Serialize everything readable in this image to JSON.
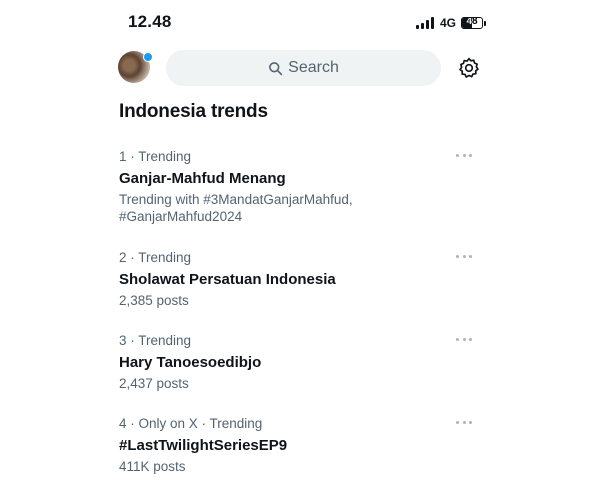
{
  "status_bar": {
    "time": "12.48",
    "network": "4G",
    "battery_level": "48",
    "battery_fraction": 0.48
  },
  "header": {
    "search_placeholder": "Search",
    "notification_dot_color": "#1d9bf0"
  },
  "section": {
    "title": "Indonesia trends"
  },
  "trends": [
    {
      "meta": "1 · Trending",
      "name": "Ganjar-Mahfud Menang",
      "sub_line1": "Trending with #3MandatGanjarMahfud,",
      "sub_line2": "#GanjarMahfud2024"
    },
    {
      "meta": "2 · Trending",
      "name": "Sholawat Persatuan Indonesia",
      "sub": "2,385 posts"
    },
    {
      "meta": "3 · Trending",
      "name": "Hary Tanoesoedibjo",
      "sub": "2,437 posts"
    },
    {
      "meta": "4 · Only on X · Trending",
      "name": "#LastTwilightSeriesEP9",
      "sub": "411K posts"
    }
  ],
  "icons": {
    "search": "search-icon",
    "settings": "gear-icon",
    "more": "more-options-icon"
  },
  "colors": {
    "text_primary": "#0f1419",
    "text_secondary": "#536471",
    "search_bg": "#eff3f4",
    "accent": "#1d9bf0"
  }
}
